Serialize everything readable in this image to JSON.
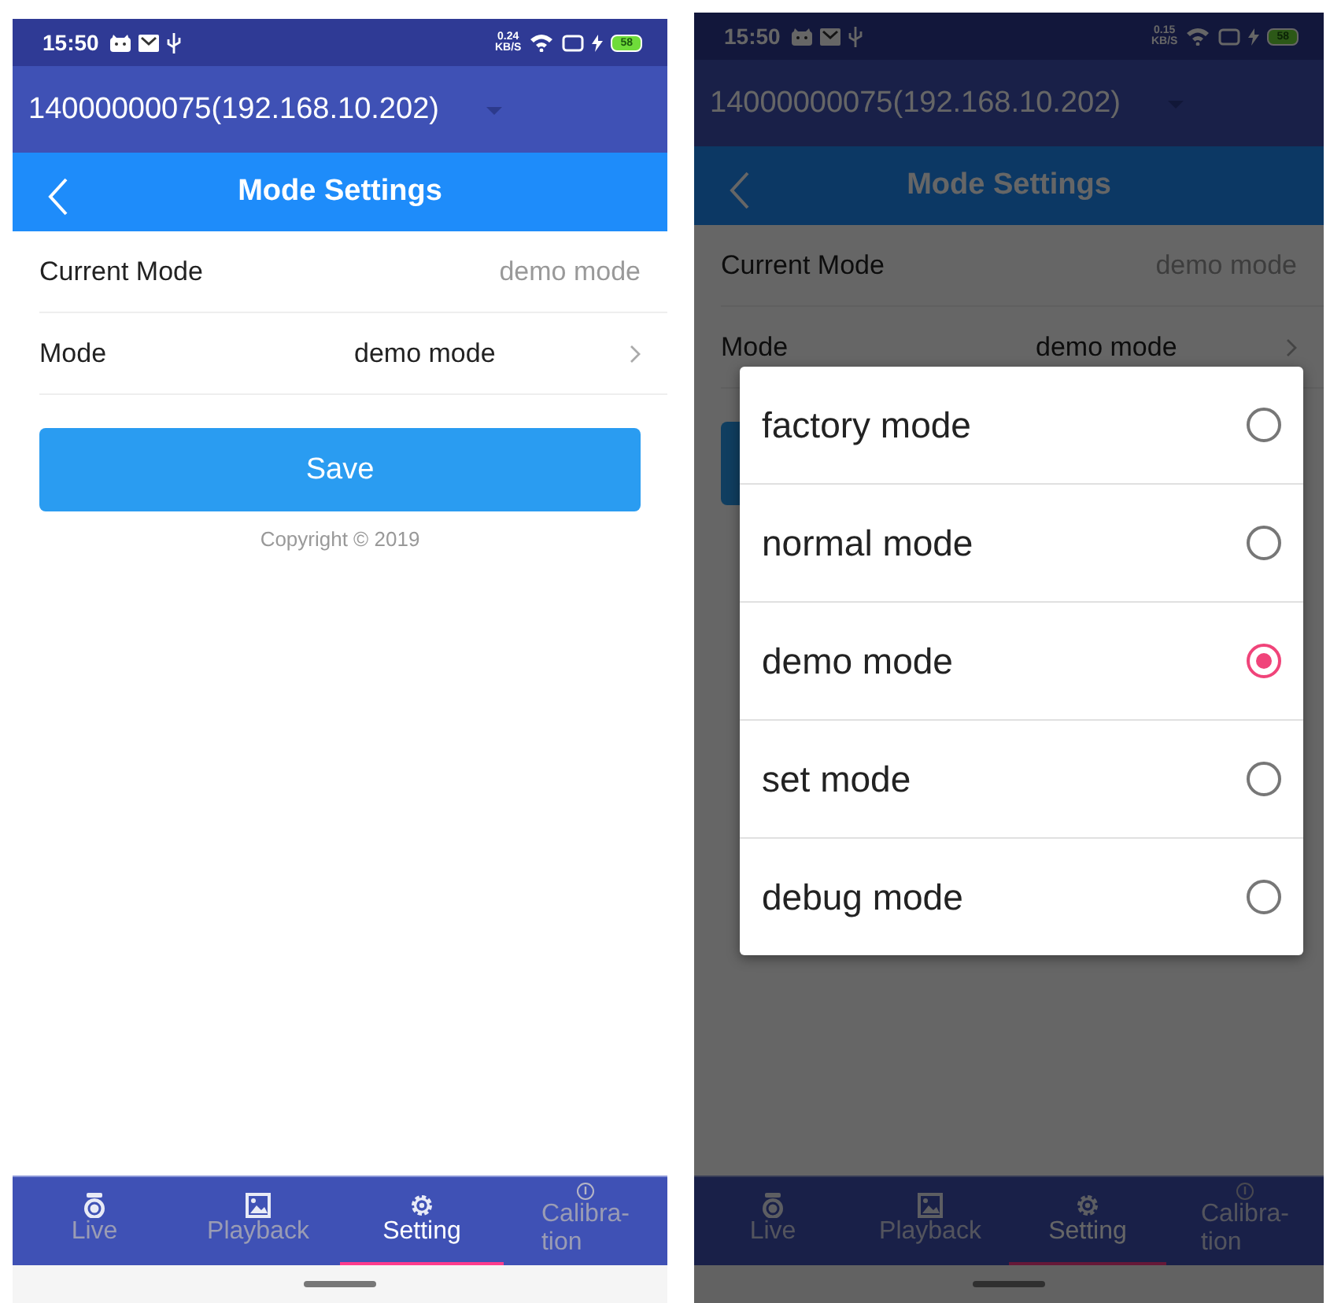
{
  "screens": [
    {
      "status_bar": {
        "time": "15:50",
        "speed": "0.24",
        "speed_unit": "KB/S",
        "battery": "58"
      },
      "device": "14000000075(192.168.10.202)",
      "title": "Mode Settings",
      "settings": [
        {
          "kind": "info",
          "label": "Current Mode",
          "value": "demo mode"
        },
        {
          "kind": "picker",
          "label": "Mode",
          "value": "demo mode"
        }
      ],
      "save_button": {
        "kind": "primary",
        "label": "Save"
      },
      "copyright": "Copyright © 2019",
      "tabs": [
        {
          "kind": "camera",
          "label": "Live",
          "selected": false
        },
        {
          "kind": "image",
          "label": "Playback",
          "selected": false
        },
        {
          "kind": "gear",
          "label": "Setting",
          "selected": true
        },
        {
          "kind": "info",
          "label": "Calibra-\ntion",
          "selected": false
        }
      ]
    },
    {
      "status_bar": {
        "time": "15:50",
        "speed": "0.15",
        "speed_unit": "KB/S",
        "battery": "58"
      },
      "device": "14000000075(192.168.10.202)",
      "title": "Mode Settings",
      "settings": [
        {
          "kind": "info",
          "label": "Current Mode",
          "value": "demo mode"
        },
        {
          "kind": "picker",
          "label": "Mode",
          "value": "demo mode"
        }
      ],
      "save_button": {
        "kind": "primary"
      },
      "tabs": [
        {
          "kind": "camera",
          "label": "Live",
          "selected": false
        },
        {
          "kind": "image",
          "label": "Playback",
          "selected": false
        },
        {
          "kind": "gear",
          "label": "Setting",
          "selected": true
        },
        {
          "kind": "info",
          "label": "Calibra-\ntion",
          "selected": false
        }
      ],
      "dialog": {
        "options": [
          {
            "label": "factory mode",
            "selected": false
          },
          {
            "label": "normal mode",
            "selected": false
          },
          {
            "label": "demo mode",
            "selected": true
          },
          {
            "label": "set mode",
            "selected": false
          },
          {
            "label": "debug mode",
            "selected": false
          }
        ]
      }
    }
  ]
}
